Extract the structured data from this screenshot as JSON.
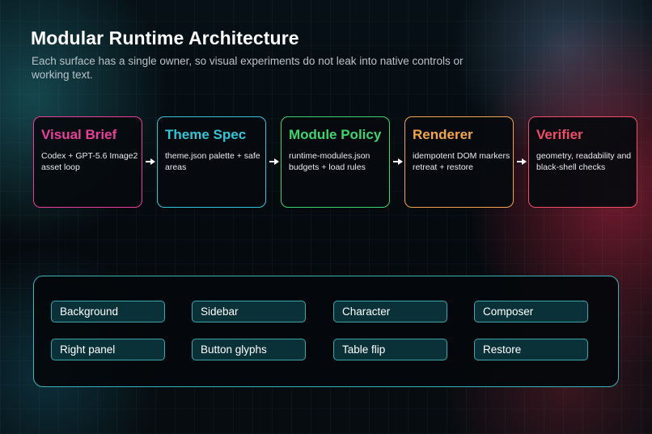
{
  "header": {
    "title": "Modular Runtime Architecture",
    "subtitle": "Each surface has a single owner, so visual experiments do not leak into native controls or working text."
  },
  "pipeline": [
    {
      "title": "Visual Brief",
      "body": "Codex + GPT-5.6 Image2 asset loop",
      "color": "#e8409a"
    },
    {
      "title": "Theme Spec",
      "body": "theme.json palette + safe areas",
      "color": "#35c3d6"
    },
    {
      "title": "Module Policy",
      "body": "runtime-modules.json budgets + load rules",
      "color": "#3ed46f"
    },
    {
      "title": "Renderer",
      "body": "idempotent DOM markers retreat + restore",
      "color": "#f3a54a"
    },
    {
      "title": "Verifier",
      "body": "geometry, readability and black-shell checks",
      "color": "#f04e66"
    }
  ],
  "modules": [
    "Background",
    "Sidebar",
    "Character",
    "Composer",
    "Right panel",
    "Button glyphs",
    "Table flip",
    "Restore"
  ],
  "colors": {
    "modules_border": "#3bb3bb",
    "chip_fill": "#0b3138"
  }
}
